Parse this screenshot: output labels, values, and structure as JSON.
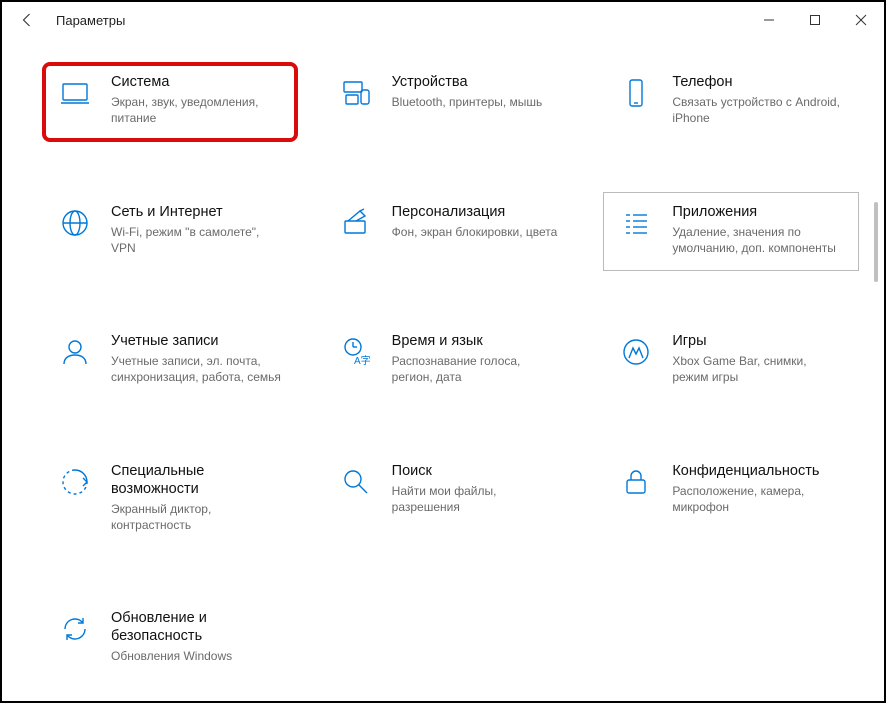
{
  "window": {
    "title": "Параметры"
  },
  "tiles": {
    "system": {
      "title": "Система",
      "desc": "Экран, звук, уведомления, питание"
    },
    "devices": {
      "title": "Устройства",
      "desc": "Bluetooth, принтеры, мышь"
    },
    "phone": {
      "title": "Телефон",
      "desc": "Связать устройство с Android, iPhone"
    },
    "network": {
      "title": "Сеть и Интернет",
      "desc": "Wi-Fi, режим \"в самолете\", VPN"
    },
    "personalization": {
      "title": "Персонализация",
      "desc": "Фон, экран блокировки, цвета"
    },
    "apps": {
      "title": "Приложения",
      "desc": "Удаление, значения по умолчанию, доп. компоненты"
    },
    "accounts": {
      "title": "Учетные записи",
      "desc": "Учетные записи, эл. почта, синхронизация, работа, семья"
    },
    "time": {
      "title": "Время и язык",
      "desc": "Распознавание голоса, регион, дата"
    },
    "gaming": {
      "title": "Игры",
      "desc": "Xbox Game Bar, снимки, режим игры"
    },
    "easeofaccess": {
      "title": "Специальные возможности",
      "desc": "Экранный диктор, контрастность"
    },
    "search": {
      "title": "Поиск",
      "desc": "Найти мои файлы, разрешения"
    },
    "privacy": {
      "title": "Конфиденциальность",
      "desc": "Расположение, камера, микрофон"
    },
    "update": {
      "title": "Обновление и безопасность",
      "desc": "Обновления Windows"
    }
  }
}
